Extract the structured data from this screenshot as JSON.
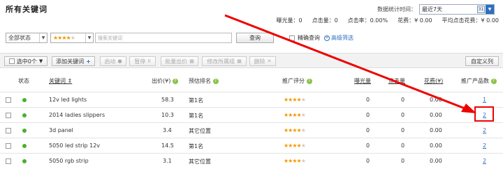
{
  "page": {
    "title": "所有关键词"
  },
  "date_range": {
    "label": "数据统计时间：",
    "value": "最近7天"
  },
  "stats": [
    {
      "label": "曝光量：",
      "value": "0"
    },
    {
      "label": "点击量：",
      "value": "0"
    },
    {
      "label": "点击率：",
      "value": "0.00%"
    },
    {
      "label": "花费：",
      "value": "¥ 0.00"
    },
    {
      "label": "平均点击花费：",
      "value": "¥ 0.00"
    }
  ],
  "filters": {
    "status_select": "全部状态",
    "rating_stars": 4,
    "search_placeholder": "搜索关键词",
    "query_button": "查询",
    "exact_label": "精确查询",
    "advanced_label": "高级筛选"
  },
  "toolbar": {
    "selected": "选中0个",
    "add": "添加关键词",
    "start": "启动",
    "pause": "暂停",
    "batch_bid": "批量出价",
    "modify_group": "修改所属组",
    "delete": "删除",
    "custom_columns": "自定义列"
  },
  "columns": {
    "status": "状态",
    "keyword": "关键词",
    "bid": "出价(¥)",
    "rank": "预估排名",
    "score": "推广评分",
    "impressions": "曝光量",
    "clicks": "点击量",
    "spend": "花费(¥)",
    "products": "推广产品数"
  },
  "rows": [
    {
      "keyword": "12v led lights",
      "bid": "58.3",
      "rank": "第1名",
      "stars": 4,
      "impressions": "0",
      "clicks": "0",
      "spend": "0.00",
      "products": "1"
    },
    {
      "keyword": "2014 ladies slippers",
      "bid": "10.3",
      "rank": "第1名",
      "stars": 4,
      "impressions": "0",
      "clicks": "0",
      "spend": "0.00",
      "products": "2"
    },
    {
      "keyword": "3d panel",
      "bid": "3.4",
      "rank": "其它位置",
      "stars": 4,
      "impressions": "0",
      "clicks": "0",
      "spend": "0.00",
      "products": "2"
    },
    {
      "keyword": "5050 led strip 12v",
      "bid": "14.5",
      "rank": "第1名",
      "stars": 4,
      "impressions": "0",
      "clicks": "0",
      "spend": "0.00",
      "products": "2"
    },
    {
      "keyword": "5050 rgb strip",
      "bid": "3.1",
      "rank": "其它位置",
      "stars": 4,
      "impressions": "0",
      "clicks": "0",
      "spend": "0.00",
      "products": "2"
    }
  ],
  "colors": {
    "accent": "#2f6fc0",
    "star": "#f39800",
    "status_on": "#48b02e",
    "annotation": "#e00000"
  }
}
